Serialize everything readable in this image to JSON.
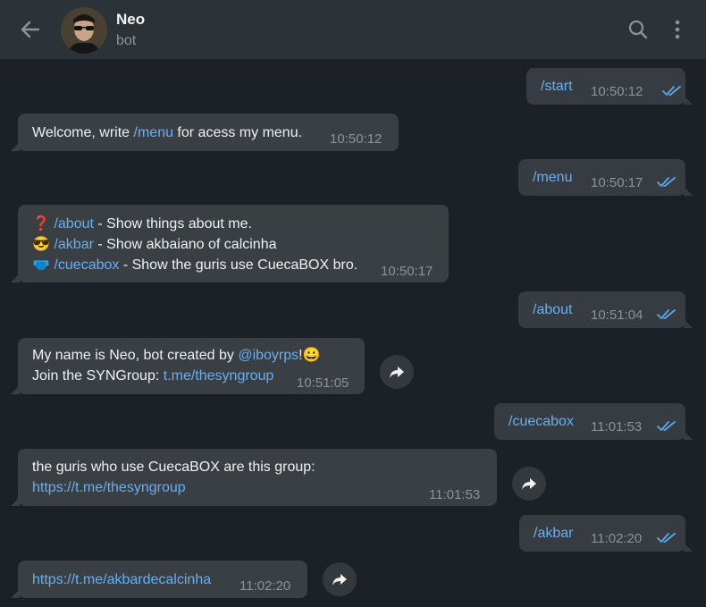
{
  "header": {
    "back_icon": "back-arrow-icon",
    "title": "Neo",
    "subtitle": "bot",
    "search_icon": "search-icon",
    "menu_icon": "more-vertical-icon"
  },
  "colors": {
    "accent": "#6aaef0",
    "check": "#5ea6e8",
    "bubble": "#363c42",
    "header": "#2b3238"
  },
  "messages": [
    {
      "dir": "out",
      "text": "/start",
      "time": "10:50:12"
    },
    {
      "dir": "in",
      "prefix": "Welcome, write ",
      "cmd": "/menu",
      "suffix": " for acess my menu.",
      "time": "10:50:12"
    },
    {
      "dir": "out",
      "text": "/menu",
      "time": "10:50:17"
    },
    {
      "dir": "in",
      "lines": [
        {
          "emoji": "❓",
          "cmd": "/about",
          "text": " - Show things about me."
        },
        {
          "emoji": "😎",
          "cmd": "/akbar",
          "text": " - Show akbaiano of calcinha"
        },
        {
          "emoji": "🩲",
          "cmd": "/cuecabox",
          "text": " - Show the guris use CuecaBOX bro."
        }
      ],
      "time": "10:50:17"
    },
    {
      "dir": "out",
      "text": "/about",
      "time": "10:51:04"
    },
    {
      "dir": "in",
      "line1_prefix": "My name is Neo, bot created by ",
      "line1_link": "@iboyrps",
      "line1_suffix": "!",
      "line1_emoji": "😀",
      "line2_prefix": "Join the SYNGroup: ",
      "line2_link": "t.me/thesyngroup",
      "time": "10:51:05"
    },
    {
      "dir": "out",
      "text": "/cuecabox",
      "time": "11:01:53"
    },
    {
      "dir": "in",
      "line1": "the guris who use CuecaBOX are this group:",
      "link": "https://t.me/thesyngroup",
      "time": "11:01:53"
    },
    {
      "dir": "out",
      "text": "/akbar",
      "time": "11:02:20"
    },
    {
      "dir": "in",
      "link": "https://t.me/akbardecalcinha",
      "time": "11:02:20"
    }
  ]
}
